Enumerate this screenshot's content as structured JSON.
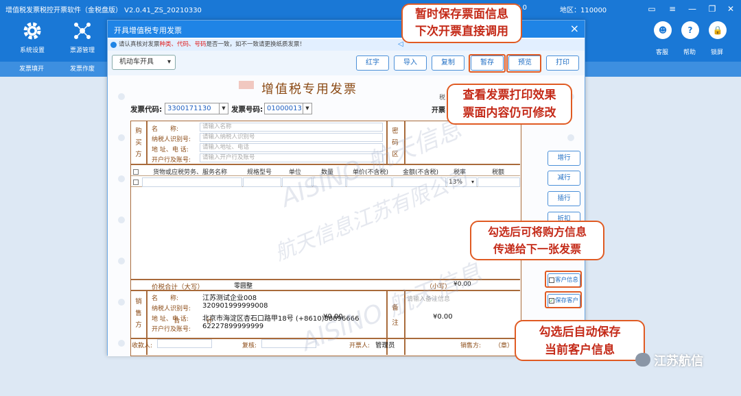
{
  "window": {
    "title": "增值税发票税控开票软件（金税盘版） V2.0.41_ZS_20210330",
    "number_text": "9008.0",
    "area_text": "地区：110000",
    "controls": [
      "▭",
      "≡",
      "—",
      "❐",
      "✕"
    ]
  },
  "toolbar": {
    "left_tools": [
      {
        "label": "系统设置",
        "icon": "gear-icon"
      },
      {
        "label": "票源管理",
        "icon": "network-icon"
      }
    ],
    "right_tools": [
      {
        "label": "客服",
        "icon": "robot-icon",
        "glyph": "☻"
      },
      {
        "label": "帮助",
        "icon": "help-icon",
        "glyph": "?"
      },
      {
        "label": "锁屏",
        "icon": "lock-icon",
        "glyph": "🔒"
      }
    ]
  },
  "subtabs": [
    "发票填开",
    "发票作废"
  ],
  "dialog": {
    "title": "开具增值税专用发票",
    "close": "×",
    "notice": {
      "prefix": "请认真核对发票",
      "highlight": "种类、代码、号码",
      "suffix": "是否一致，如不一致请更换纸质发票！"
    },
    "dropdown": {
      "value": "机动车开具",
      "arrow": "▾"
    },
    "buttons": [
      "红字",
      "导入",
      "复制",
      "暂存",
      "预览",
      "打印"
    ]
  },
  "invoice": {
    "title": "增值税专用发票",
    "code_label": "发票代码:",
    "code_value": "3300171130",
    "number_label": "发票号码:",
    "number_value": "01000013",
    "side_label_1": "税",
    "side_label_2": "开票",
    "buyer": {
      "side": [
        "购",
        "买",
        "方"
      ],
      "rows": [
        {
          "label": "名　　称:",
          "placeholder": "请输入名称"
        },
        {
          "label": "纳税人识别号:",
          "placeholder": "请输入纳税人识别号"
        },
        {
          "label": "地 址、电 话:",
          "placeholder": "请输入地址、电话"
        },
        {
          "label": "开户行及账号:",
          "placeholder": "请输入开户行及账号"
        }
      ]
    },
    "password_area": [
      "密",
      "码",
      "区"
    ],
    "columns": [
      "货物或应税劳务、服务名称",
      "规格型号",
      "单位",
      "数量",
      "单价(不含税)",
      "金额(不含税)",
      "税率",
      "税额"
    ],
    "first_row_tax_rate": "13%",
    "total": {
      "label": "合　　　　计",
      "amount": "¥0.00",
      "tax": "¥0.00"
    },
    "total_with_tax": {
      "label": "价税合计（大写）",
      "upper": "零圆整",
      "lower_label": "（小写）",
      "lower": "¥0.00"
    },
    "seller": {
      "side": [
        "销",
        "售",
        "方"
      ],
      "rows": [
        {
          "label": "名　　称:",
          "value": "江苏测试企业008"
        },
        {
          "label": "纳税人识别号:",
          "value": "320901999999008"
        },
        {
          "label": "地 址、电 话:",
          "value": "北京市海淀区杏石口路甲18号 (+8610)88896666"
        },
        {
          "label": "开户行及账号:",
          "value": "62227899999999"
        }
      ]
    },
    "remark_side": [
      "备",
      "注"
    ],
    "remark_placeholder": "请输入备注信息",
    "footer": {
      "payee": "收款人:",
      "reviewer": "复核:",
      "drawer_label": "开票人:",
      "drawer": "管理员",
      "seller_label": "销售方:",
      "seal": "（章）"
    }
  },
  "side_buttons": [
    "增行",
    "减行",
    "插行",
    "折扣"
  ],
  "checkboxes": [
    {
      "label": "客户信息",
      "checked": false
    },
    {
      "label": "保存客户",
      "checked": true
    }
  ],
  "callouts": [
    {
      "lines": [
        "暂时保存票面信息",
        "下次开票直接调用"
      ]
    },
    {
      "lines": [
        "查看发票打印效果",
        "票面内容仍可修改"
      ]
    },
    {
      "lines": [
        "勾选后可将购方信息",
        "传递给下一张发票"
      ]
    },
    {
      "lines": [
        "勾选后自动保存",
        "当前客户信息"
      ]
    }
  ],
  "watermark": [
    "AISINO 航天信息",
    "航天信息江苏有限公司"
  ],
  "brand": "江苏航信",
  "colors": {
    "primary": "#1a78d6",
    "invoice_brown": "#a86a3a",
    "callout": "#e05a22"
  }
}
